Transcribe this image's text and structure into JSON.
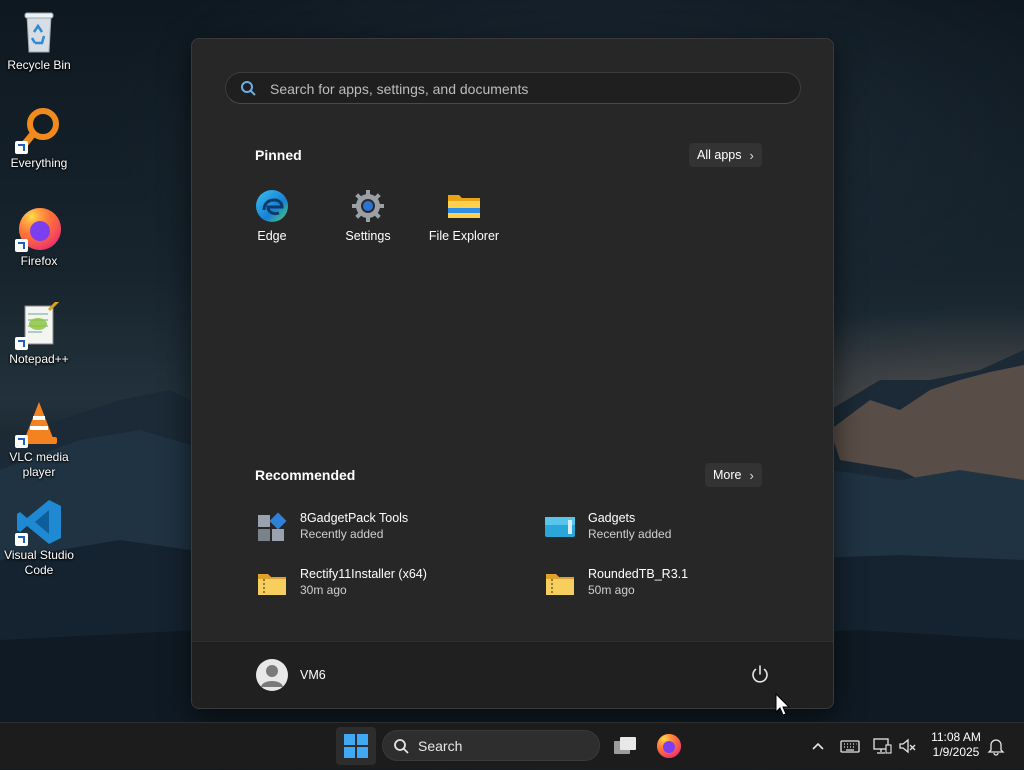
{
  "desktop": {
    "icons": [
      {
        "label": "Recycle Bin"
      },
      {
        "label": "Everything"
      },
      {
        "label": "Firefox"
      },
      {
        "label": "Notepad++"
      },
      {
        "label": "VLC media player"
      },
      {
        "label": "Visual Studio Code"
      }
    ]
  },
  "start_menu": {
    "search_placeholder": "Search for apps, settings, and documents",
    "pinned_title": "Pinned",
    "all_apps_label": "All apps",
    "pinned": [
      {
        "label": "Edge",
        "icon": "edge-icon"
      },
      {
        "label": "Settings",
        "icon": "settings-gear-icon"
      },
      {
        "label": "File Explorer",
        "icon": "folder-icon"
      }
    ],
    "recommended_title": "Recommended",
    "more_label": "More",
    "recommended": [
      {
        "name": "8GadgetPack Tools",
        "sub": "Recently added"
      },
      {
        "name": "Gadgets",
        "sub": "Recently added"
      },
      {
        "name": "Rectify11Installer (x64)",
        "sub": "30m ago"
      },
      {
        "name": "RoundedTB_R3.1",
        "sub": "50m ago"
      }
    ],
    "user": {
      "name": "VM6"
    }
  },
  "taskbar": {
    "search_label": "Search",
    "clock": {
      "time": "11:08 AM",
      "date": "1/9/2025"
    }
  },
  "colors": {
    "start_bg": "#272727",
    "footer_bg": "#202020",
    "taskbar_bg": "#1c1c1c",
    "accent": "#0078d4"
  }
}
